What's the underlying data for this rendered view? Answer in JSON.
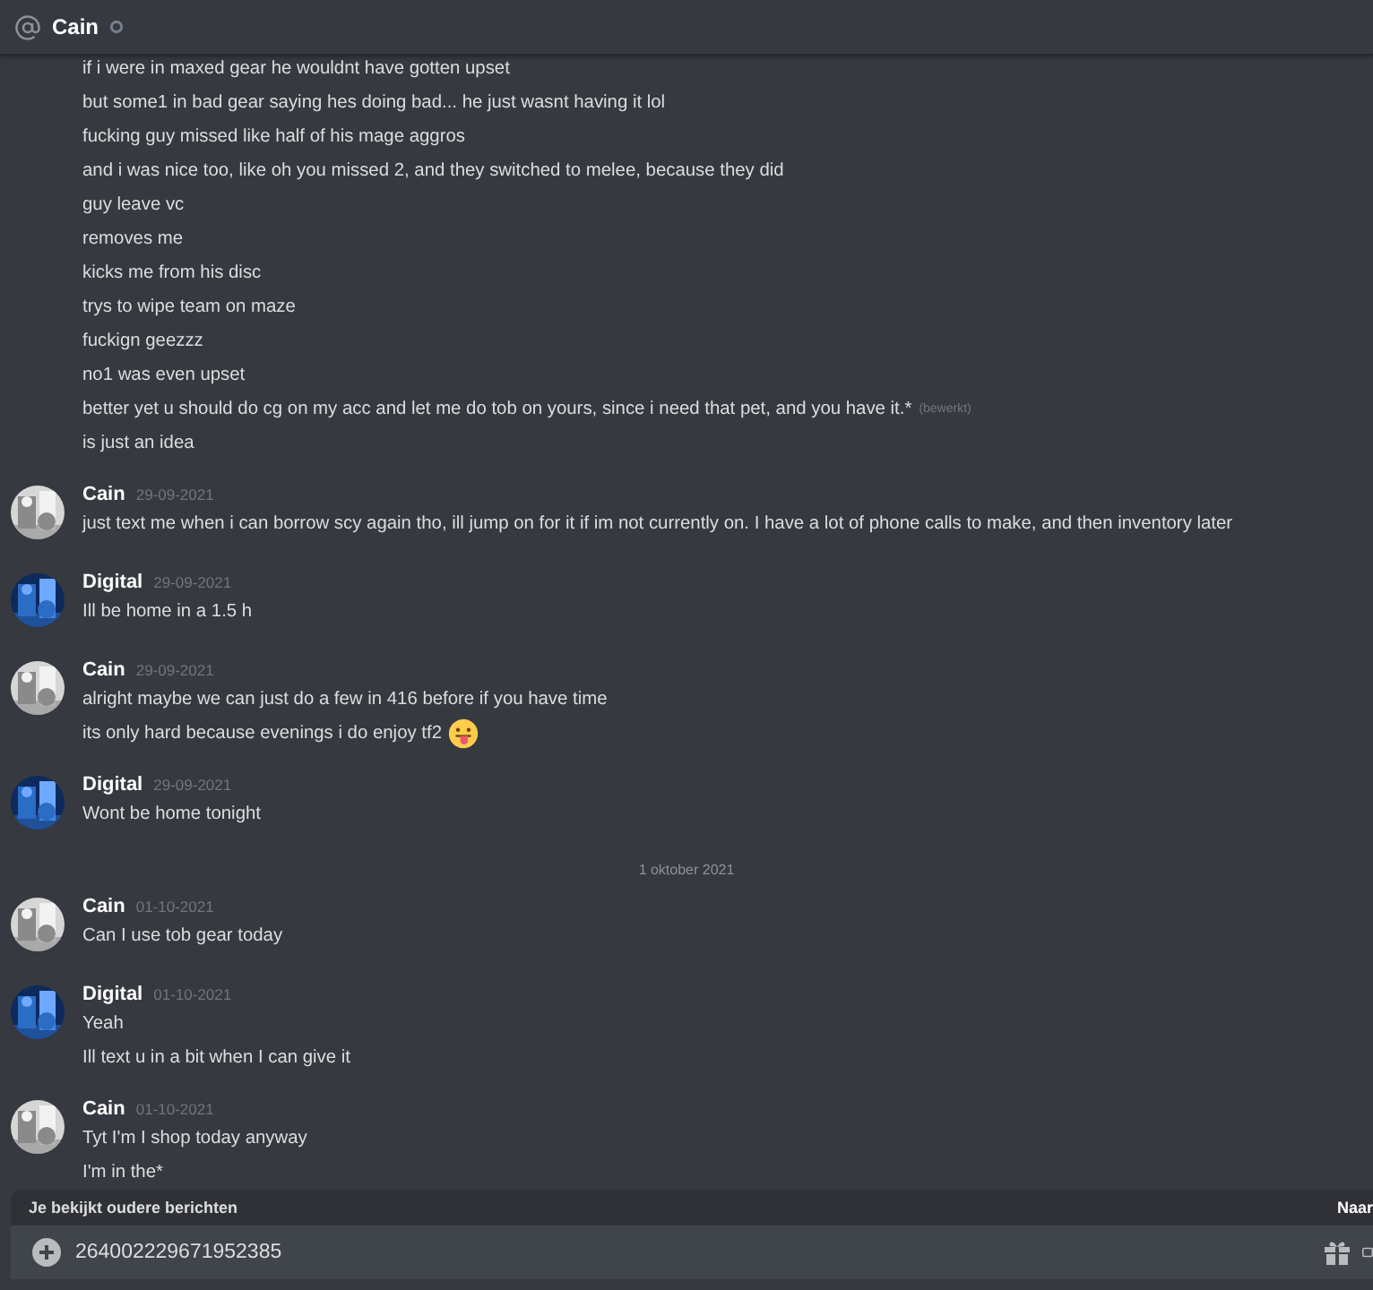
{
  "header": {
    "name": "Cain",
    "online": false
  },
  "feed": [
    {
      "kind": "group",
      "lines": [
        {
          "text": "if i were in maxed gear he wouldnt have gotten upset"
        },
        {
          "text": "but some1 in bad gear saying hes doing bad... he just wasnt having it lol"
        },
        {
          "text": "fucking guy missed like half of his mage aggros"
        },
        {
          "text": "and i was nice too, like oh you missed 2, and they switched to melee, because they did"
        },
        {
          "text": "guy leave vc"
        },
        {
          "text": "removes me"
        },
        {
          "text": "kicks me from his disc"
        },
        {
          "text": "trys to wipe team on maze"
        },
        {
          "text": "fuckign geezzz"
        },
        {
          "text": "no1 was even upset"
        },
        {
          "text": "better yet u should do cg on my acc and let me do tob on yours, since i need that pet, and you have it.*",
          "edited": "(bewerkt)"
        },
        {
          "text": "is just an idea"
        }
      ]
    },
    {
      "kind": "group",
      "author": "Cain",
      "date": "29-09-2021",
      "lines": [
        {
          "text": "just text me when i can borrow scy again tho, ill jump on for it if im not currently on. I have a lot of phone calls to make, and then inventory later"
        }
      ]
    },
    {
      "kind": "group",
      "author": "Digital",
      "date": "29-09-2021",
      "lines": [
        {
          "text": "Ill be home in a 1.5 h"
        }
      ]
    },
    {
      "kind": "group",
      "author": "Cain",
      "date": "29-09-2021",
      "lines": [
        {
          "text": "alright maybe we can just do a few in 416 before if you have time"
        },
        {
          "text": "its only hard because evenings i do enjoy tf2",
          "emoji": true
        }
      ]
    },
    {
      "kind": "group",
      "author": "Digital",
      "date": "29-09-2021",
      "lines": [
        {
          "text": "Wont be home tonight"
        }
      ]
    },
    {
      "kind": "divider",
      "label": "1 oktober 2021"
    },
    {
      "kind": "group",
      "author": "Cain",
      "date": "01-10-2021",
      "lines": [
        {
          "text": "Can I use tob gear today"
        }
      ]
    },
    {
      "kind": "group",
      "author": "Digital",
      "date": "01-10-2021",
      "lines": [
        {
          "text": "Yeah"
        },
        {
          "text": "Ill text u in a bit when I can give it"
        }
      ]
    },
    {
      "kind": "group",
      "author": "Cain",
      "date": "01-10-2021",
      "lines": [
        {
          "text": "Tyt I'm I shop today anyway"
        },
        {
          "text": "I'm in the*"
        }
      ]
    }
  ],
  "older_bar": {
    "label": "Je bekijkt oudere berichten",
    "action": "Naar"
  },
  "composer": {
    "value": "264002229671952385"
  }
}
